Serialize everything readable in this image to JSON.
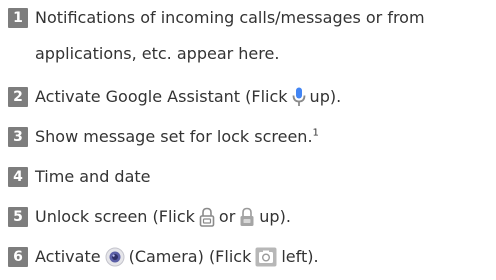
{
  "items": [
    {
      "number": "1",
      "line1": "Notifications of incoming calls/messages or from",
      "line2": "applications, etc. appear here."
    },
    {
      "number": "2",
      "text_before": "Activate Google Assistant (Flick",
      "text_after": "up).",
      "icon": "microphone-icon"
    },
    {
      "number": "3",
      "text": "Show message set for lock screen.",
      "footnote": "1"
    },
    {
      "number": "4",
      "text": "Time and date"
    },
    {
      "number": "5",
      "text_before": "Unlock screen (Flick",
      "text_mid": "or",
      "text_after": "up).",
      "icons": [
        "lock-icon-outline",
        "lock-icon-filled"
      ]
    },
    {
      "number": "6",
      "text_before": "Activate",
      "text_mid": "(Camera) (Flick",
      "text_after": "left).",
      "icons": [
        "camera-app-icon",
        "camera-button-icon"
      ]
    }
  ],
  "colors": {
    "badge_bg": "#7d7d7d",
    "badge_fg": "#ffffff",
    "text": "#333333",
    "microphone": "#4285f4"
  }
}
